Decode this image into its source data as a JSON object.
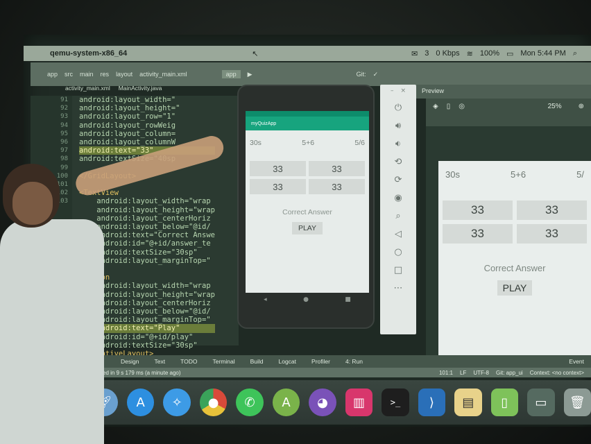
{
  "menubar": {
    "app_name": "qemu-system-x86_64",
    "battery": "100%",
    "clock": "Mon 5:44 PM",
    "kbps": "0 Kbps",
    "mail_count": "3"
  },
  "ide": {
    "breadcrumbs": [
      "app",
      "src",
      "main",
      "res",
      "layout",
      "activity_main.xml"
    ],
    "run_config": "app",
    "git_label": "Git:",
    "tabs": [
      "activity_main.xml",
      "MainActivity.java"
    ],
    "code_lines": [
      "android:layout_width=\"",
      "android:layout_height=\"",
      "android:layout_row=\"1\"",
      "android:layout_rowWeig",
      "android:layout_column=",
      "android:layout_columnW",
      "android:text=\"33\"",
      "android:textSize=\"40sp",
      "",
      "</GridLayout>",
      "",
      "<TextView",
      "    android:layout_width=\"wrap",
      "    android:layout_height=\"wrap",
      "    android:layout_centerHoriz",
      "    android:layout_below=\"@id/",
      "    android:text=\"Correct Answe",
      "    android:id=\"@+id/answer_te",
      "    android:textSize=\"30sp\"",
      "    android:layout_marginTop=\"",
      "",
      "<Button",
      "    android:layout_width=\"wrap",
      "    android:layout_height=\"wrap",
      "    android:layout_centerHoriz",
      "    android:layout_below=\"@id/",
      "    android:layout_marginTop=\"",
      "    android:text=\"Play\"",
      "    android:id=\"@+id/play\"",
      "    android:textSize=\"30sp\"",
      "</RelativeLayout>"
    ],
    "line_numbers": [
      "91",
      "92",
      "93",
      "94",
      "95",
      "96",
      "97",
      "98",
      "99",
      "100",
      "101",
      "102",
      "103"
    ],
    "design_tabs": [
      "Design",
      "Text"
    ],
    "bottom_tabs": [
      "TODO",
      "Terminal",
      "Build",
      "Logcat",
      "Profiler",
      "4: Run"
    ],
    "status_msg": "Gradle build finished in 9 s 179 ms (a minute ago)",
    "status_right": [
      "101:1",
      "LF",
      "UTF-8",
      "Git: app_ui",
      "Context: <no context>"
    ],
    "event_log": "Event"
  },
  "phone": {
    "app_title": "myQuizApp",
    "timer": "30s",
    "question": "5+6",
    "score": "5/6",
    "answers": [
      "33",
      "33",
      "33",
      "33"
    ],
    "result": "Correct Answer",
    "play_label": "PLAY"
  },
  "preview": {
    "title": "Preview",
    "zoom": "25%",
    "timer": "30s",
    "question": "5+6",
    "score": "5/",
    "answers": [
      "33",
      "33",
      "33",
      "33"
    ],
    "result": "Correct Answer",
    "play_label": "PLAY"
  },
  "dock": {
    "icons": [
      "finder-icon",
      "launchpad-icon",
      "appstore-icon",
      "safari-icon",
      "chrome-icon",
      "whatsapp-icon",
      "android-studio-icon",
      "github-icon",
      "slides-icon",
      "terminal-icon",
      "vscode-icon",
      "preview-icon",
      "files-icon",
      "desktop-icon",
      "trash-icon"
    ]
  }
}
